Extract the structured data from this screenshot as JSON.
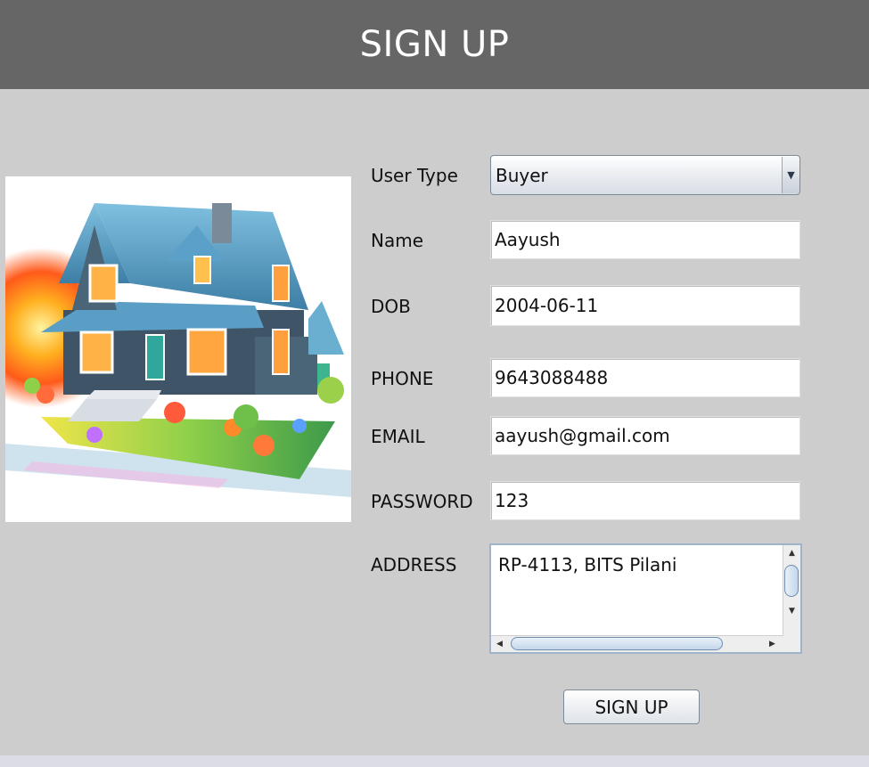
{
  "header": {
    "title": "SIGN UP"
  },
  "form": {
    "user_type": {
      "label": "User Type",
      "value": "Buyer"
    },
    "name": {
      "label": "Name",
      "value": "Aayush"
    },
    "dob": {
      "label": "DOB",
      "value": "2004-06-11"
    },
    "phone": {
      "label": "PHONE",
      "value": "9643088488"
    },
    "email": {
      "label": "EMAIL",
      "value": "aayush@gmail.com"
    },
    "password": {
      "label": "PASSWORD",
      "value": "123"
    },
    "address": {
      "label": "ADDRESS",
      "value": "RP-4113, BITS Pilani"
    }
  },
  "submit_label": "SIGN UP",
  "icons": {
    "combo_arrow": "chevron-down-icon",
    "scroll_up": "scroll-up-arrow-icon",
    "scroll_down": "scroll-down-arrow-icon",
    "scroll_left": "scroll-left-arrow-icon",
    "scroll_right": "scroll-right-arrow-icon"
  },
  "colors": {
    "header_bg": "#666666",
    "page_bg": "#cdcdcd",
    "header_text": "#ffffff"
  }
}
